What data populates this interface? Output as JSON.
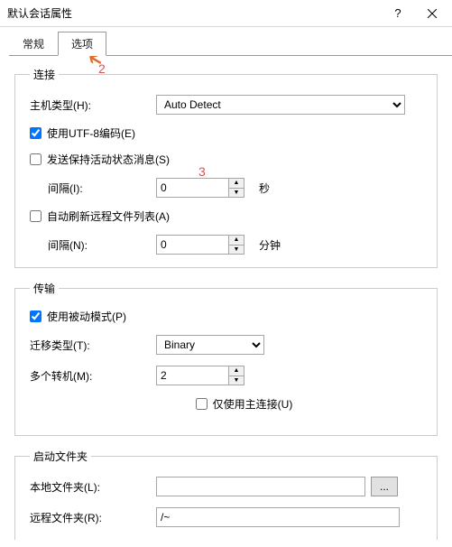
{
  "window": {
    "title": "默认会话属性"
  },
  "tabs": {
    "general": "常规",
    "options": "选项"
  },
  "annotations": {
    "n2": "2",
    "n3": "3"
  },
  "conn": {
    "legend": "连接",
    "host_type_label": "主机类型(H):",
    "host_type_value": "Auto Detect",
    "utf8_label": "使用UTF-8编码(E)",
    "keepalive_label": "发送保持活动状态消息(S)",
    "interval1_label": "间隔(I):",
    "interval1_value": "0",
    "interval1_unit": "秒",
    "autorefresh_label": "自动刷新远程文件列表(A)",
    "interval2_label": "间隔(N):",
    "interval2_value": "0",
    "interval2_unit": "分钟"
  },
  "trans": {
    "legend": "传输",
    "passive_label": "使用被动模式(P)",
    "transfer_type_label": "迁移类型(T):",
    "transfer_type_value": "Binary",
    "multi_label": "多个转机(M):",
    "multi_value": "2",
    "main_only_label": "仅使用主连接(U)"
  },
  "startup": {
    "legend": "启动文件夹",
    "local_label": "本地文件夹(L):",
    "local_value": "",
    "remote_label": "远程文件夹(R):",
    "remote_value": "/~",
    "browse": "..."
  }
}
